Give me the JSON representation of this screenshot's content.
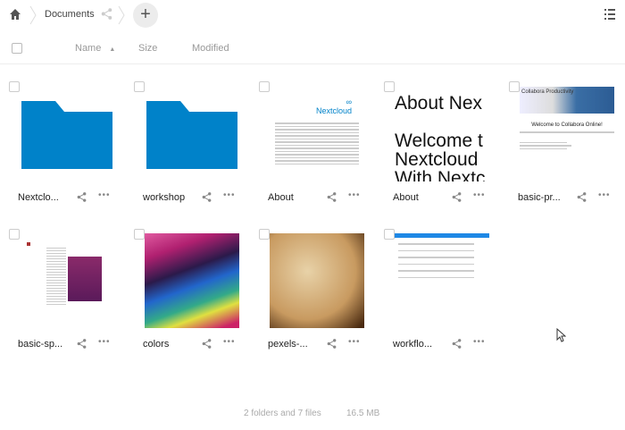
{
  "breadcrumb": {
    "folder": "Documents"
  },
  "header": {
    "name": "Name",
    "size": "Size",
    "modified": "Modified",
    "sort_indicator": "▲"
  },
  "files": [
    {
      "name": "Nextclo...",
      "type": "folder"
    },
    {
      "name": "workshop",
      "type": "folder"
    },
    {
      "name": "About",
      "type": "doc-nextcloud",
      "thumb_text": "Nextcloud"
    },
    {
      "name": "About",
      "type": "doc-big",
      "thumb_lines": [
        "About Nex",
        "",
        "Welcome t",
        "Nextcloud",
        "With Nextc"
      ]
    },
    {
      "name": "basic-pr...",
      "type": "presentation",
      "thumb_title": "Collabora Productivity",
      "thumb_heading": "Welcome to Collabora Online!"
    },
    {
      "name": "basic-sp...",
      "type": "spreadsheet"
    },
    {
      "name": "colors",
      "type": "image-colors"
    },
    {
      "name": "pexels-...",
      "type": "image-book"
    },
    {
      "name": "workflo...",
      "type": "form"
    }
  ],
  "summary": {
    "counts": "2 folders and 7 files",
    "size": "16.5 MB"
  },
  "colors": {
    "folder": "#0082c9",
    "accent": "#0082c9"
  }
}
